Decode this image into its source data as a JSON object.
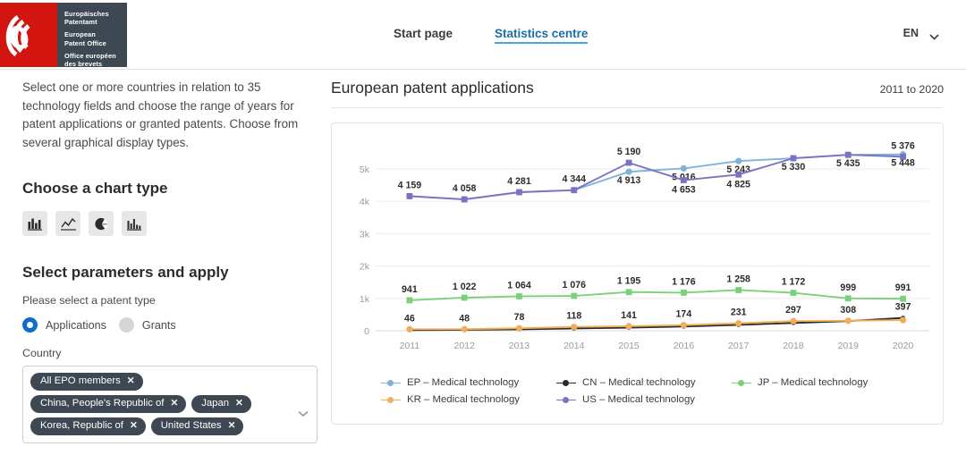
{
  "header": {
    "logo": {
      "line1": "Europäisches",
      "line2": "Patentamt",
      "line3": "European",
      "line4": "Patent Office",
      "line5": "Office européen",
      "line6": "des brevets"
    },
    "nav": [
      {
        "label": "Start page",
        "active": false
      },
      {
        "label": "Statistics centre",
        "active": true
      }
    ],
    "language": "EN"
  },
  "sidebar": {
    "intro": "Select one or more countries in relation to 35 technology fields and choose the range of years for patent applications or granted patents. Choose from several graphical display types.",
    "chart_type_heading": "Choose a chart type",
    "chart_types": [
      {
        "name": "bar-chart-icon",
        "label": "Bar chart"
      },
      {
        "name": "line-chart-icon",
        "label": "Line chart"
      },
      {
        "name": "pie-chart-icon",
        "label": "Pie chart"
      },
      {
        "name": "column-chart-icon",
        "label": "Column chart"
      }
    ],
    "parameters_heading": "Select parameters and apply",
    "patent_type_label": "Please select a patent type",
    "patent_types": [
      {
        "label": "Applications",
        "selected": true
      },
      {
        "label": "Grants",
        "selected": false
      }
    ],
    "country_label": "Country",
    "country_chips": [
      "All EPO members",
      "China, People's Republic of",
      "Japan",
      "Korea, Republic of",
      "United States"
    ],
    "remove_chip_glyph": "✕",
    "dropdown_icon": "chevron-down-icon"
  },
  "chart": {
    "title": "European patent applications",
    "range": "2011 to 2020"
  },
  "chart_data": {
    "type": "line",
    "title": "European patent applications",
    "subtitle": "2011 to 2020",
    "xlabel": "",
    "ylabel": "",
    "x": [
      2011,
      2012,
      2013,
      2014,
      2015,
      2016,
      2017,
      2018,
      2019,
      2020
    ],
    "categories": [
      "2011",
      "2012",
      "2013",
      "2014",
      "2015",
      "2016",
      "2017",
      "2018",
      "2019",
      "2020"
    ],
    "ylim": [
      0,
      5800
    ],
    "yticks": [
      0,
      1000,
      2000,
      3000,
      4000,
      5000
    ],
    "ytick_labels": [
      "0",
      "1k",
      "2k",
      "3k",
      "4k",
      "5k"
    ],
    "grid": true,
    "legend_position": "bottom",
    "series": [
      {
        "name": "EP – Medical technology",
        "color": "#7FB4D8",
        "values": [
          4159,
          4058,
          4281,
          4344,
          4913,
          5016,
          5243,
          5330,
          5435,
          5448
        ],
        "labels": [
          "4 159",
          "4 058",
          "4 281",
          "4 344",
          "4 913",
          "5 016",
          "5 243",
          "5 330",
          "5 435",
          "5 448"
        ]
      },
      {
        "name": "CN – Medical technology",
        "color": "#2b2b2b",
        "values": [
          20,
          28,
          45,
          70,
          96,
          130,
          180,
          240,
          300,
          397
        ],
        "labels": [
          "",
          "",
          "",
          "",
          "",
          "",
          "",
          "",
          "",
          "397"
        ]
      },
      {
        "name": "JP – Medical technology",
        "color": "#7BD17B",
        "values": [
          941,
          1022,
          1064,
          1076,
          1195,
          1176,
          1258,
          1172,
          999,
          991
        ],
        "labels": [
          "941",
          "1 022",
          "1 064",
          "1 076",
          "1 195",
          "1 176",
          "1 258",
          "1 172",
          "999",
          "991"
        ]
      },
      {
        "name": "KR – Medical technology",
        "color": "#F0AE5A",
        "values": [
          46,
          48,
          78,
          118,
          141,
          174,
          231,
          297,
          308,
          330
        ],
        "labels": [
          "46",
          "48",
          "78",
          "118",
          "141",
          "174",
          "231",
          "297",
          "308",
          ""
        ]
      },
      {
        "name": "US – Medical technology",
        "color": "#7B72C4",
        "values": [
          4159,
          4058,
          4281,
          4344,
          5190,
          4653,
          4825,
          5330,
          5435,
          5376
        ],
        "labels": [
          "",
          "",
          "",
          "",
          "5 190",
          "4 653",
          "4 825",
          "",
          "",
          "5 376"
        ]
      }
    ],
    "top_labels": [
      {
        "x": 2015,
        "text": "5 190",
        "series": "US – Medical technology"
      },
      {
        "x": 2016,
        "text": "5 016",
        "series": "EP – Medical technology"
      },
      {
        "x": 2017,
        "text": "5 243",
        "series": "EP – Medical technology"
      },
      {
        "x": 2018,
        "text": "5 330",
        "series": "EP – Medical technology"
      },
      {
        "x": 2020,
        "text": "5 376",
        "series": "US – Medical technology"
      }
    ]
  }
}
